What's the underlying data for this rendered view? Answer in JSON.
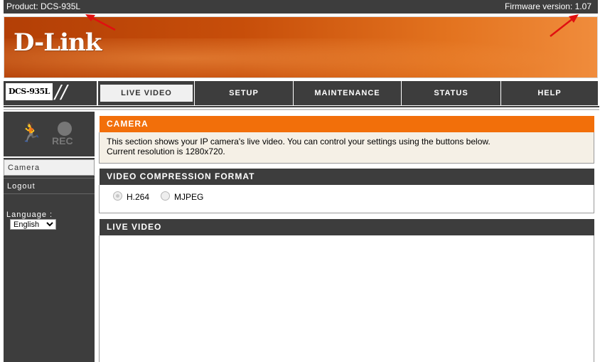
{
  "header": {
    "product": "Product: DCS-935L",
    "firmware": "Firmware version: 1.07"
  },
  "banner": {
    "logo": "D-Link"
  },
  "nav": {
    "model": "DCS-935L",
    "tabs": [
      "LIVE VIDEO",
      "SETUP",
      "MAINTENANCE",
      "STATUS",
      "HELP"
    ],
    "active_tab": "LIVE VIDEO"
  },
  "sidebar": {
    "rec": "REC",
    "items": [
      "Camera",
      "Logout"
    ],
    "language_label": "Language :",
    "language_value": "English"
  },
  "camera": {
    "title": "CAMERA",
    "line1": "This section shows your IP camera's live video. You can control your settings using the buttons below.",
    "line2": "Current resolution is 1280x720."
  },
  "compression": {
    "title": "VIDEO COMPRESSION FORMAT",
    "options": [
      "H.264",
      "MJPEG"
    ],
    "selected": "H.264"
  },
  "live_video": {
    "title": "LIVE VIDEO"
  },
  "colors": {
    "accent": "#f26f0a",
    "dark": "#3d3d3d"
  }
}
